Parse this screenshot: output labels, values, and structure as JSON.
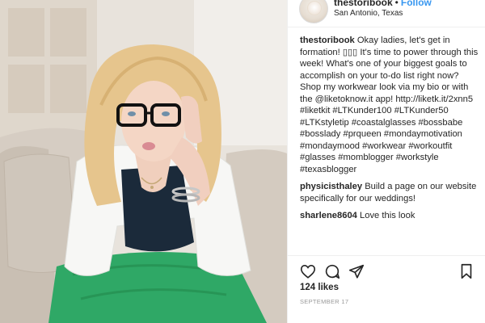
{
  "post": {
    "photo_alt": "Woman in glasses and white jacket sitting on a couch",
    "header": {
      "username": "thestoribook",
      "separator": "•",
      "follow_label": "Follow",
      "location": "San Antonio, Texas"
    },
    "comments": [
      {
        "user": "thestoribook",
        "text": "Okay ladies, let's get in formation! ▯▯▯ It's time to power through this week! What's one of your biggest goals to accomplish on your to-do list right now? Shop my workwear look via my bio or with the @liketoknow.it app! http://liketk.it/2xnn5 #liketkit #LTKunder100 #LTKunder50 #LTKstyletip #coastalglasses #bossbabe #bosslady #prqueen #mondaymotivation #mondaymood #workwear #workoutfit #glasses #momblogger #workstyle #texasblogger"
      },
      {
        "user": "physicisthaley",
        "text": "Build a page on our website specifically for our weddings!"
      },
      {
        "user": "sharlene8604",
        "text": "Love this look"
      }
    ],
    "likes": "124 likes",
    "date": "SEPTEMBER 17",
    "icons": {
      "like": "heart-icon",
      "comment": "comment-icon",
      "share": "share-icon",
      "save": "bookmark-icon"
    },
    "colors": {
      "link": "#3897f0",
      "text": "#262626",
      "muted": "#999999",
      "border": "#efefef"
    }
  }
}
